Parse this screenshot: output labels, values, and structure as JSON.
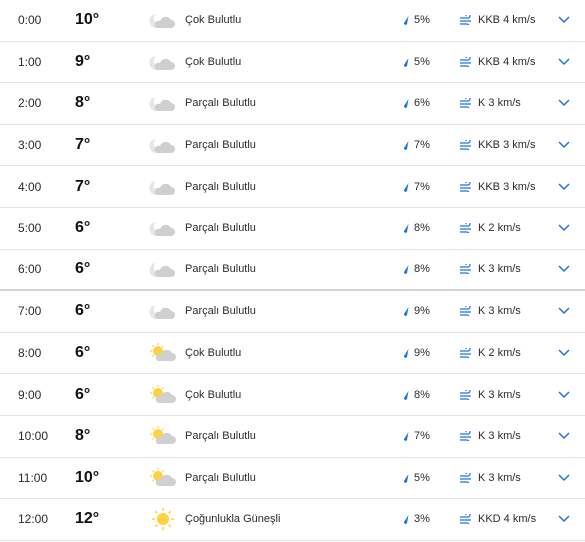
{
  "colors": {
    "accent": "#1a73e8",
    "cloud": "#c9c9c9",
    "sun": "#ffd23f",
    "divider": "#e3e3e3"
  },
  "hours": [
    {
      "time": "0:00",
      "temp": "10°",
      "icon": "cloud-night-icon",
      "condition": "Çok Bulutlu",
      "precip": "5%",
      "wind": "KKB 4 km/s"
    },
    {
      "time": "1:00",
      "temp": "9°",
      "icon": "cloud-night-icon",
      "condition": "Çok Bulutlu",
      "precip": "5%",
      "wind": "KKB 4 km/s"
    },
    {
      "time": "2:00",
      "temp": "8°",
      "icon": "cloud-night-icon",
      "condition": "Parçalı Bulutlu",
      "precip": "6%",
      "wind": "K 3 km/s"
    },
    {
      "time": "3:00",
      "temp": "7°",
      "icon": "cloud-night-icon",
      "condition": "Parçalı Bulutlu",
      "precip": "7%",
      "wind": "KKB 3 km/s"
    },
    {
      "time": "4:00",
      "temp": "7°",
      "icon": "cloud-night-icon",
      "condition": "Parçalı Bulutlu",
      "precip": "7%",
      "wind": "KKB 3 km/s"
    },
    {
      "time": "5:00",
      "temp": "6°",
      "icon": "cloud-night-icon",
      "condition": "Parçalı Bulutlu",
      "precip": "8%",
      "wind": "K 2 km/s"
    },
    {
      "time": "6:00",
      "temp": "6°",
      "icon": "cloud-night-icon",
      "condition": "Parçalı Bulutlu",
      "precip": "8%",
      "wind": "K 3 km/s"
    },
    {
      "time": "7:00",
      "temp": "6°",
      "icon": "cloud-night-icon",
      "condition": "Parçalı Bulutlu",
      "precip": "9%",
      "wind": "K 3 km/s"
    },
    {
      "time": "8:00",
      "temp": "6°",
      "icon": "sun-cloud-icon",
      "condition": "Çok Bulutlu",
      "precip": "9%",
      "wind": "K 2 km/s"
    },
    {
      "time": "9:00",
      "temp": "6°",
      "icon": "sun-cloud-icon",
      "condition": "Çok Bulutlu",
      "precip": "8%",
      "wind": "K 3 km/s"
    },
    {
      "time": "10:00",
      "temp": "8°",
      "icon": "sun-cloud-icon",
      "condition": "Parçalı Bulutlu",
      "precip": "7%",
      "wind": "K 3 km/s"
    },
    {
      "time": "11:00",
      "temp": "10°",
      "icon": "sun-cloud-icon",
      "condition": "Parçalı Bulutlu",
      "precip": "5%",
      "wind": "K 3 km/s"
    },
    {
      "time": "12:00",
      "temp": "12°",
      "icon": "sun-icon",
      "condition": "Çoğunlukla Güneşli",
      "precip": "3%",
      "wind": "KKD 4 km/s"
    }
  ]
}
